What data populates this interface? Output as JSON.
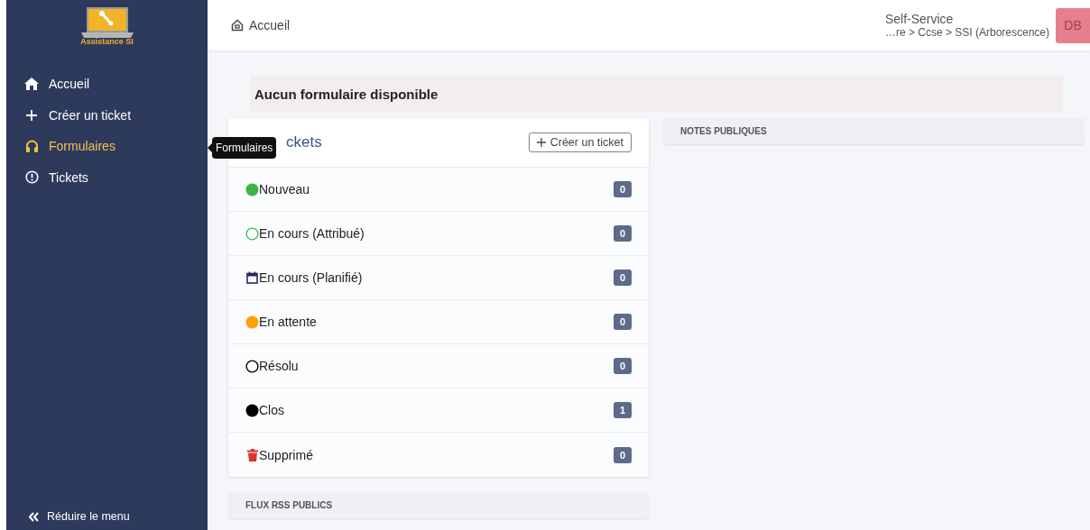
{
  "sidebar": {
    "logo_text": "Assistance SI",
    "items": [
      {
        "label": "Accueil",
        "kind": "home",
        "selected": false
      },
      {
        "label": "Créer un ticket",
        "kind": "plus",
        "selected": false
      },
      {
        "label": "Formulaires",
        "kind": "headset",
        "selected": true
      },
      {
        "label": "Tickets",
        "kind": "alert",
        "selected": false
      }
    ],
    "collapse": "Réduire le menu"
  },
  "tooltip": "Formulaires",
  "header": {
    "breadcrumb": "Accueil",
    "profile": "Self-Service",
    "entity": "…re > Ccse > SSI (Arborescence)",
    "avatar": "DB"
  },
  "alert": "Aucun formulaire disponible",
  "tickets": {
    "title": "ckets",
    "create_button": "Créer un ticket",
    "rows": [
      {
        "kind": "dot",
        "color": "#3bb54a",
        "label": "Nouveau",
        "count": "0"
      },
      {
        "kind": "ring",
        "color": "#4cbb5a",
        "label": "En cours (Attribué)",
        "count": "0"
      },
      {
        "kind": "calendar",
        "color": "#1f2d5a",
        "label": "En cours (Planifié)",
        "count": "0"
      },
      {
        "kind": "dot",
        "color": "#ff9f0a",
        "label": "En attente",
        "count": "0"
      },
      {
        "kind": "ring",
        "color": "#000000",
        "label": "Résolu",
        "count": "0"
      },
      {
        "kind": "dot",
        "color": "#000000",
        "label": "Clos",
        "count": "1"
      },
      {
        "kind": "trash",
        "color": "#e03131",
        "label": "Supprimé",
        "count": "0"
      }
    ]
  },
  "notes_panel": "NOTES PUBLIQUES",
  "rss_panel": "FLUX RSS PUBLICS"
}
